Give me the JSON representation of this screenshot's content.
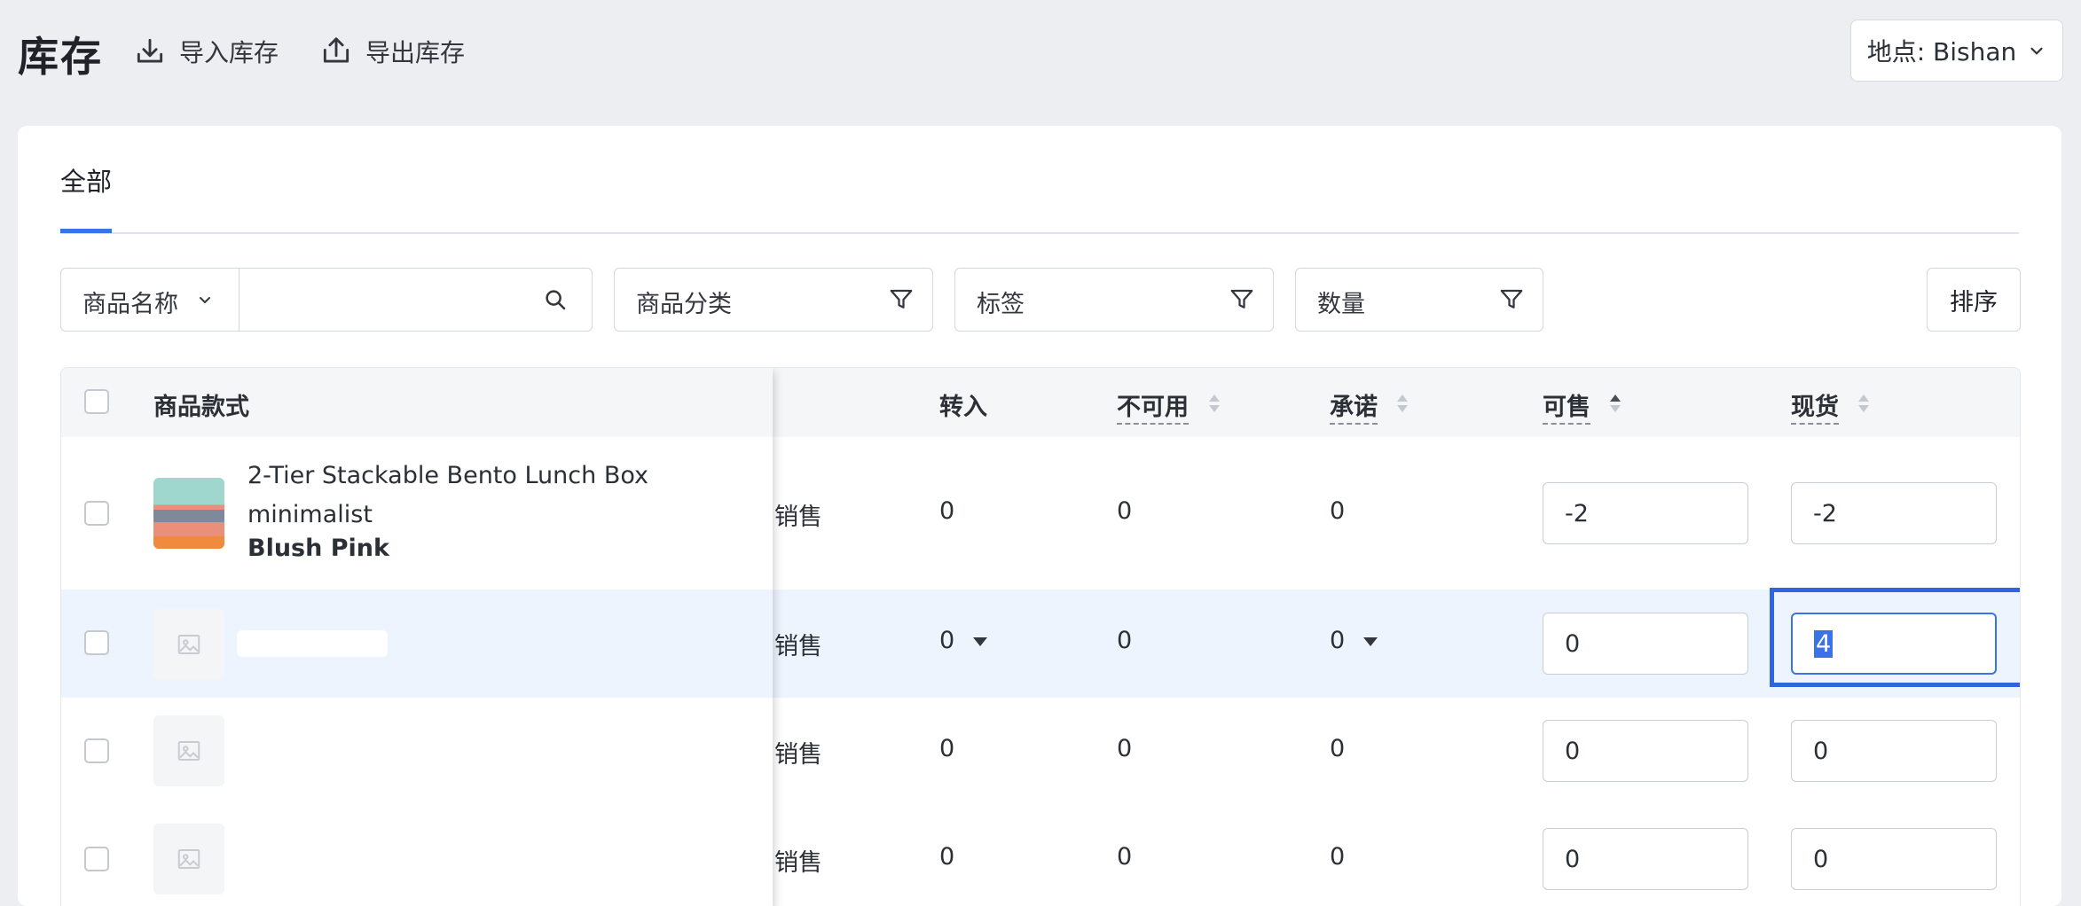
{
  "header": {
    "title": "库存",
    "import_label": "导入库存",
    "export_label": "导出库存",
    "location_label": "地点: Bishan"
  },
  "tabs": [
    {
      "label": "全部",
      "active": true
    }
  ],
  "filters": {
    "search_field_label": "商品名称",
    "search_value": "",
    "category_label": "商品分类",
    "tags_label": "标签",
    "quantity_label": "数量",
    "sort_label": "排序"
  },
  "table": {
    "columns": {
      "product": "商品款式",
      "transfer_in": "转入",
      "unavailable": "不可用",
      "committed": "承诺",
      "available": "可售",
      "on_hand": "现货"
    },
    "rows": [
      {
        "product_name": "2-Tier Stackable Bento Lunch Box minimalist",
        "variant": "Blush Pink",
        "channel": "销售",
        "transfer_in": "0",
        "unavailable": "0",
        "committed": "0",
        "available": "-2",
        "on_hand": "-2"
      },
      {
        "product_name": "",
        "variant": "",
        "channel": "销售",
        "transfer_in": "0",
        "unavailable": "0",
        "committed": "0",
        "available": "0",
        "on_hand": "4",
        "selected": true
      },
      {
        "product_name": "",
        "variant": "",
        "channel": "销售",
        "transfer_in": "0",
        "unavailable": "0",
        "committed": "0",
        "available": "0",
        "on_hand": "0"
      },
      {
        "product_name": "",
        "variant": "",
        "channel": "销售",
        "transfer_in": "0",
        "unavailable": "0",
        "committed": "0",
        "available": "0",
        "on_hand": "0"
      }
    ]
  },
  "colors": {
    "accent": "#3a73e8",
    "page_bg": "#eceef2",
    "selected_row_bg": "#eef4fd"
  },
  "icons": [
    "import-icon",
    "export-icon",
    "chevron-down-icon",
    "search-icon",
    "filter-icon",
    "sort-icon",
    "image-placeholder-icon",
    "dropdown-caret-icon"
  ]
}
